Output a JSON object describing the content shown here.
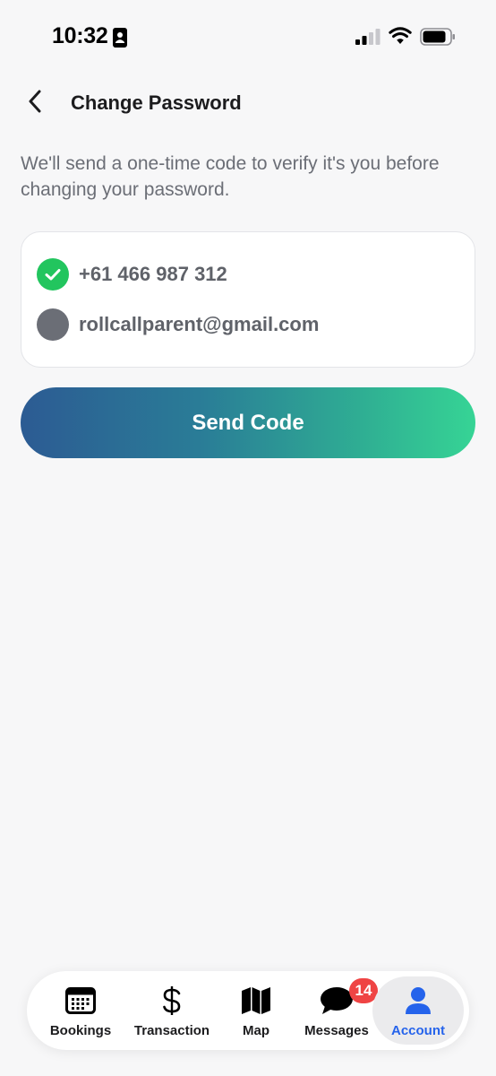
{
  "status_bar": {
    "time": "10:32",
    "icons": [
      "contact-card-icon",
      "cellular-signal-icon",
      "wifi-icon",
      "battery-icon"
    ]
  },
  "header": {
    "title": "Change Password",
    "back_icon": "chevron-left-icon"
  },
  "description": "We'll send a one-time code to verify it's you before changing your password.",
  "options": [
    {
      "label": "+61 466 987 312",
      "selected": true
    },
    {
      "label": "rollcallparent@gmail.com",
      "selected": false
    }
  ],
  "send_button": {
    "label": "Send Code"
  },
  "tabs": [
    {
      "label": "Bookings",
      "icon": "calendar-icon"
    },
    {
      "label": "Transaction",
      "icon": "dollar-icon"
    },
    {
      "label": "Map",
      "icon": "map-icon"
    },
    {
      "label": "Messages",
      "icon": "chat-bubble-icon",
      "badge": "14"
    },
    {
      "label": "Account",
      "icon": "person-icon",
      "active": true
    }
  ],
  "colors": {
    "accent": "#2563eb",
    "success": "#22c55e",
    "badge": "#ef4444",
    "button_gradient_start": "#2c5b93",
    "button_gradient_end": "#36d495"
  }
}
